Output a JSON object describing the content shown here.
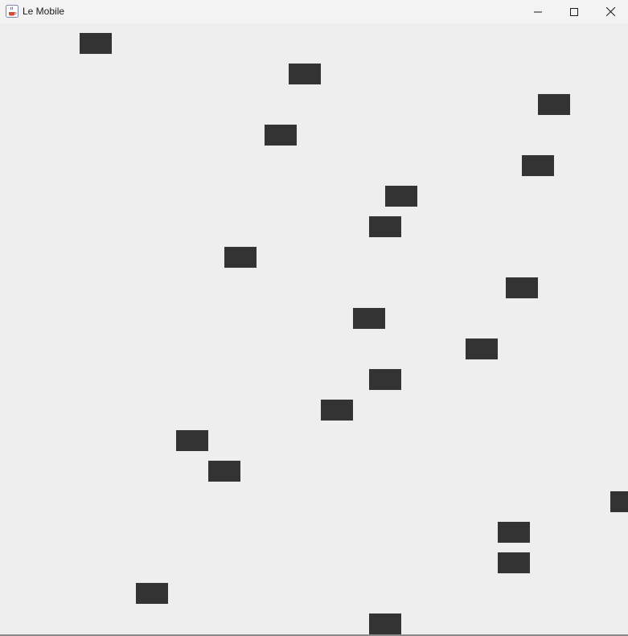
{
  "window": {
    "title": "Le Mobile",
    "app_icon": "java-coffee-cup-icon",
    "controls": {
      "minimize_icon": "minimize-icon",
      "maximize_icon": "maximize-icon",
      "close_icon": "close-icon"
    }
  },
  "colors": {
    "background": "#eeeeee",
    "titlebar": "#f3f3f3",
    "block": "#333333"
  }
}
